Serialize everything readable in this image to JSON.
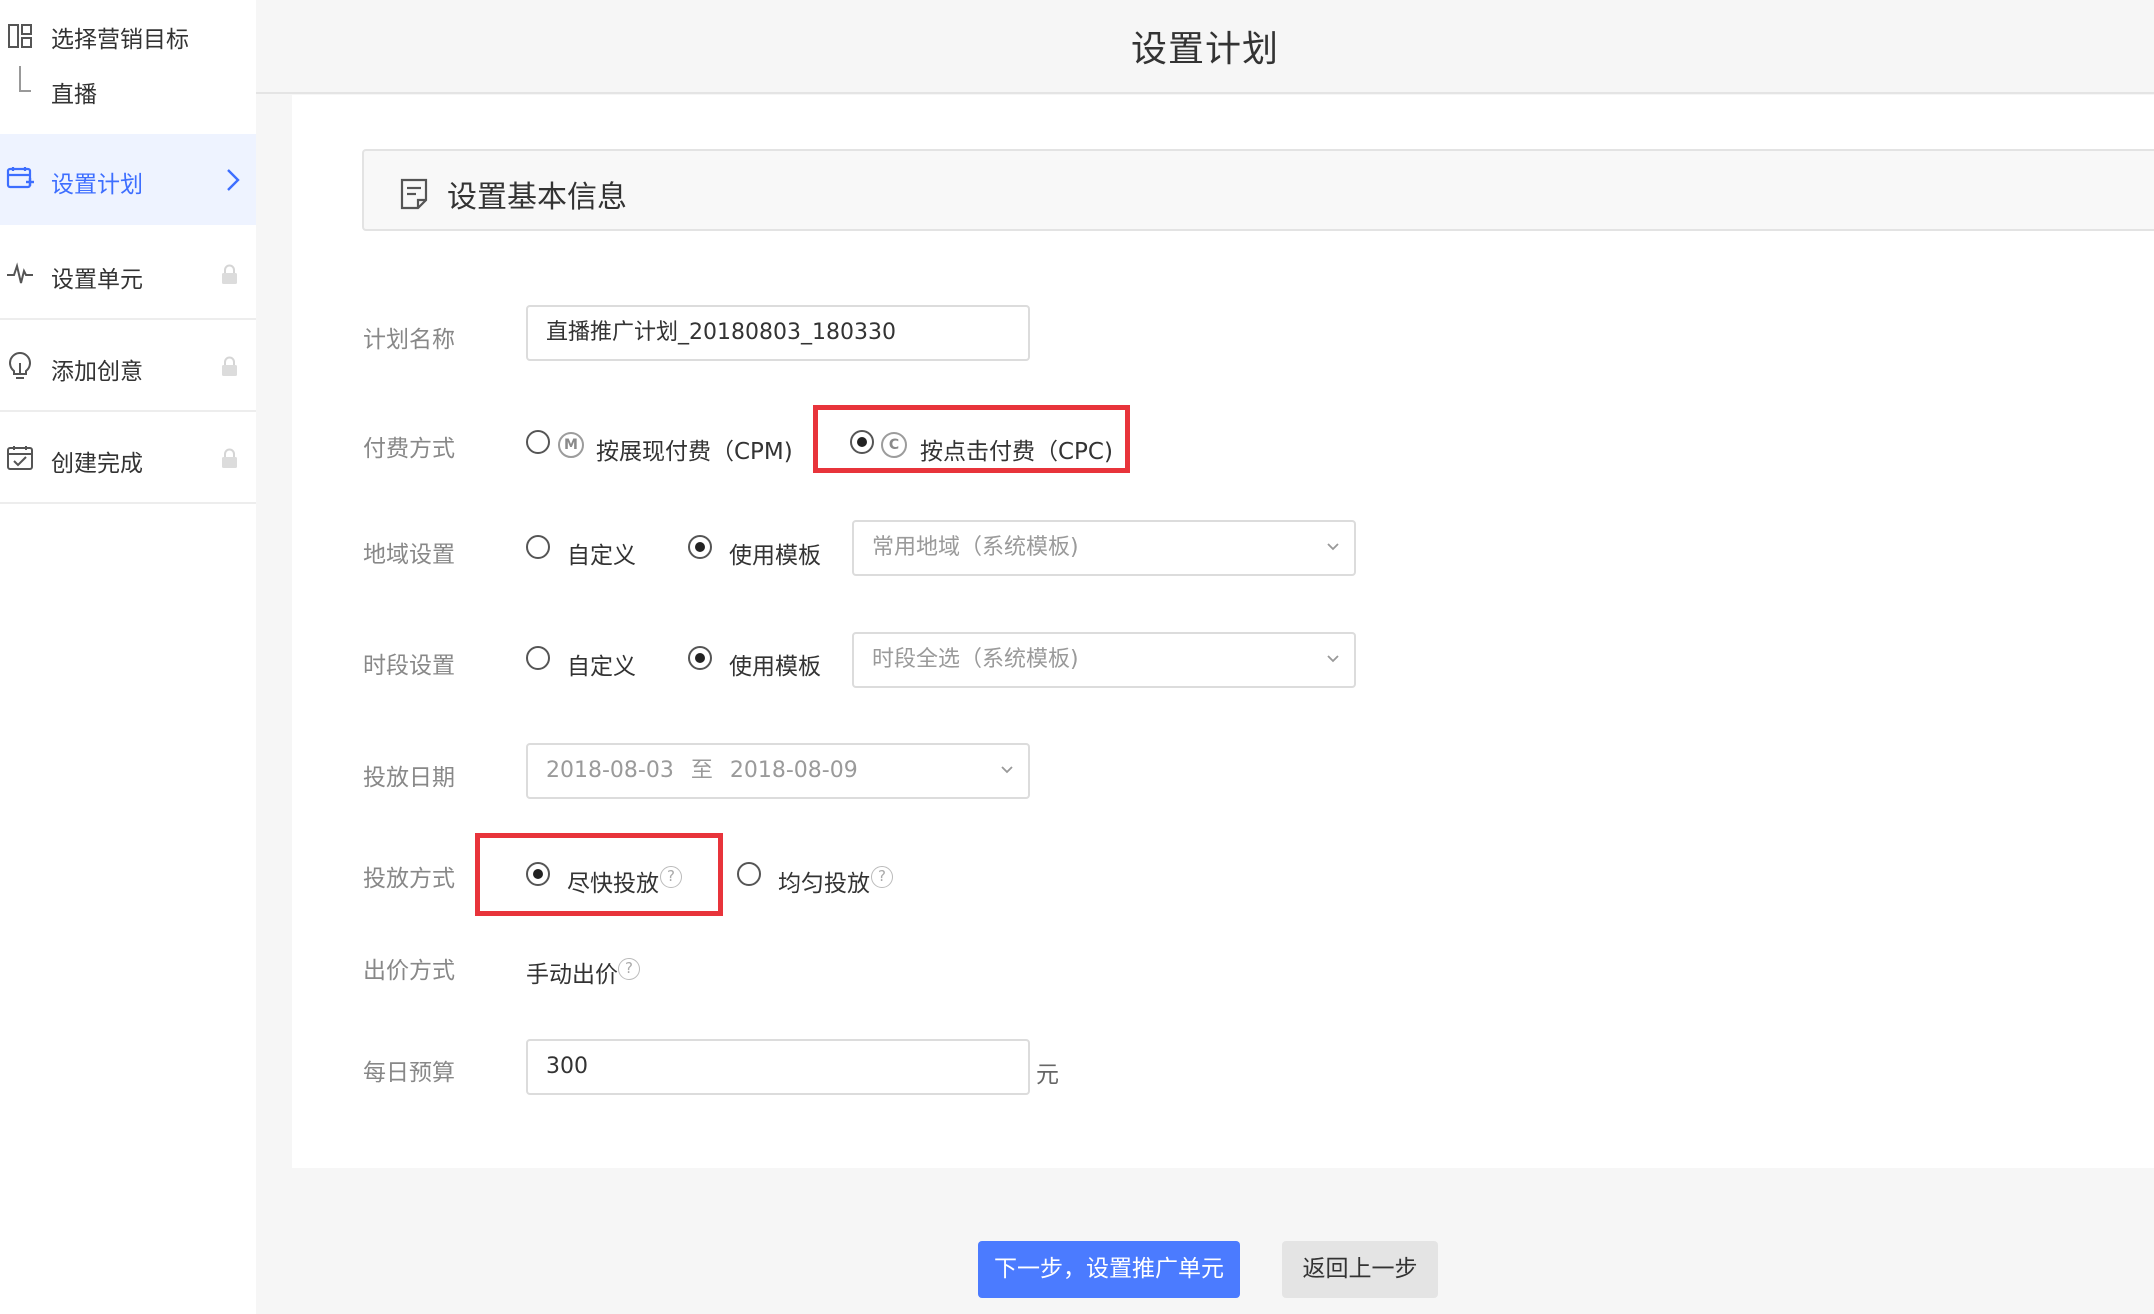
{
  "sidebar": {
    "goal_label": "选择营销目标",
    "goal_sub_label": "直播",
    "items": [
      {
        "label": "设置计划",
        "icon": "plan-icon",
        "state": "active"
      },
      {
        "label": "设置单元",
        "icon": "pulse-icon",
        "state": "locked"
      },
      {
        "label": "添加创意",
        "icon": "bulb-icon",
        "state": "locked"
      },
      {
        "label": "创建完成",
        "icon": "calendar-check-icon",
        "state": "locked"
      }
    ]
  },
  "header": {
    "title": "设置计划"
  },
  "section": {
    "title": "设置基本信息",
    "icon": "document-icon"
  },
  "form": {
    "plan_name": {
      "label": "计划名称",
      "value": "直播推广计划_20180803_180330"
    },
    "billing": {
      "label": "付费方式",
      "options": [
        {
          "badge": "M",
          "label": "按展现付费（CPM)",
          "checked": false
        },
        {
          "badge": "C",
          "label": "按点击付费（CPC)",
          "checked": true
        }
      ]
    },
    "region": {
      "label": "地域设置",
      "options": [
        {
          "label": "自定义",
          "checked": false
        },
        {
          "label": "使用模板",
          "checked": true
        }
      ],
      "template_value": "常用地域（系统模板)"
    },
    "time_slot": {
      "label": "时段设置",
      "options": [
        {
          "label": "自定义",
          "checked": false
        },
        {
          "label": "使用模板",
          "checked": true
        }
      ],
      "template_value": "时段全选（系统模板)"
    },
    "date": {
      "label": "投放日期",
      "start": "2018-08-03",
      "separator": "至",
      "end": "2018-08-09"
    },
    "delivery": {
      "label": "投放方式",
      "options": [
        {
          "label": "尽快投放",
          "checked": true
        },
        {
          "label": "均匀投放",
          "checked": false
        }
      ]
    },
    "bid": {
      "label": "出价方式",
      "value": "手动出价"
    },
    "budget": {
      "label": "每日预算",
      "value": "300",
      "unit": "元"
    }
  },
  "help_glyph": "?",
  "buttons": {
    "next": "下一步，设置推广单元",
    "back": "返回上一步"
  },
  "colors": {
    "accent": "#4b7bff",
    "active_text": "#3d6eff",
    "highlight": "#e8343b",
    "active_bg": "#eef3ff"
  }
}
